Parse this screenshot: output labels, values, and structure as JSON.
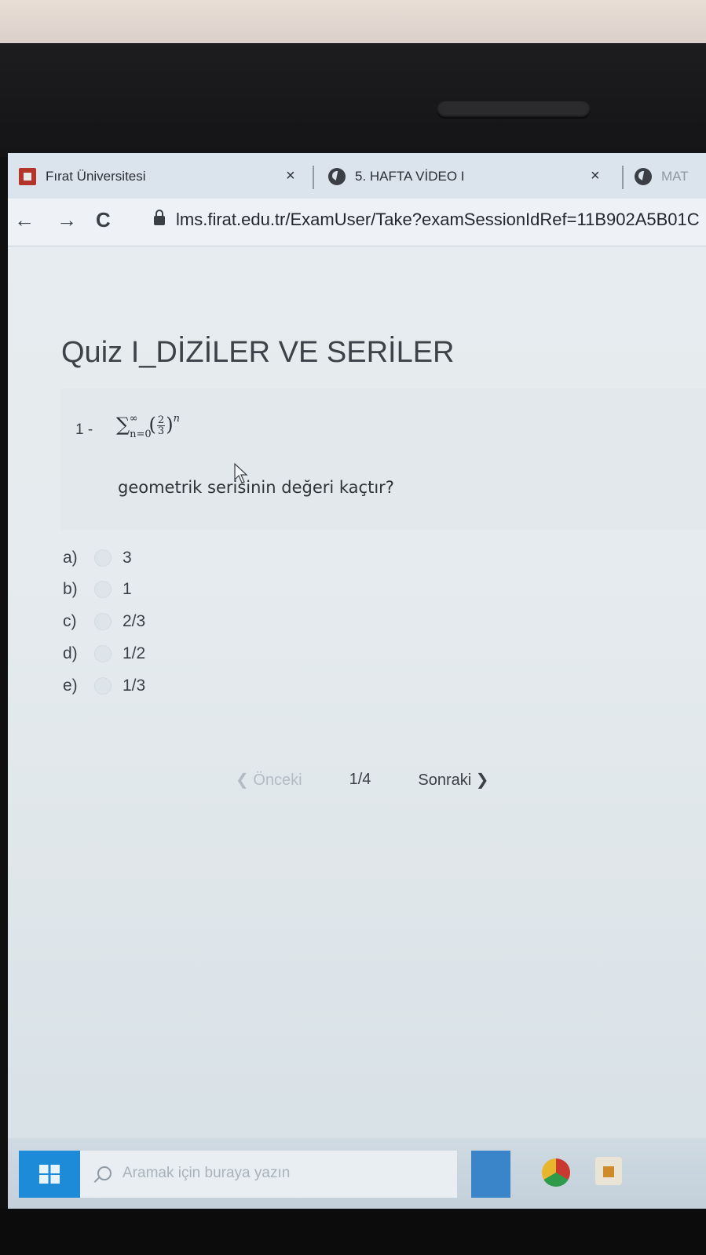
{
  "tabs": [
    {
      "title": "Fırat Üniversitesi",
      "close": "×"
    },
    {
      "title": "5. HAFTA VİDEO I",
      "close": "×"
    },
    {
      "title": "MAT"
    }
  ],
  "nav": {
    "back": "←",
    "forward": "→",
    "reload": "C"
  },
  "address": {
    "url": "lms.firat.edu.tr/ExamUser/Take?examSessionIdRef=11B902A5B01C"
  },
  "exam": {
    "title": "Quiz I_DİZİLER VE SERİLER",
    "question": {
      "number": "1 -",
      "formula": {
        "sigma": "∑",
        "upper": "∞",
        "lower": "n=0",
        "numerator": "2",
        "denominator": "3",
        "exponent": "n"
      },
      "text": "geometrik serisinin değeri kaçtır?"
    },
    "options": [
      {
        "letter": "a)",
        "value": "3"
      },
      {
        "letter": "b)",
        "value": "1"
      },
      {
        "letter": "c)",
        "value": "2/3"
      },
      {
        "letter": "d)",
        "value": "1/2"
      },
      {
        "letter": "e)",
        "value": "1/3"
      }
    ],
    "pager": {
      "prev": "Önceki",
      "indicator": "1/4",
      "next": "Sonraki"
    }
  },
  "taskbar": {
    "search_placeholder": "Aramak için buraya yazın"
  }
}
